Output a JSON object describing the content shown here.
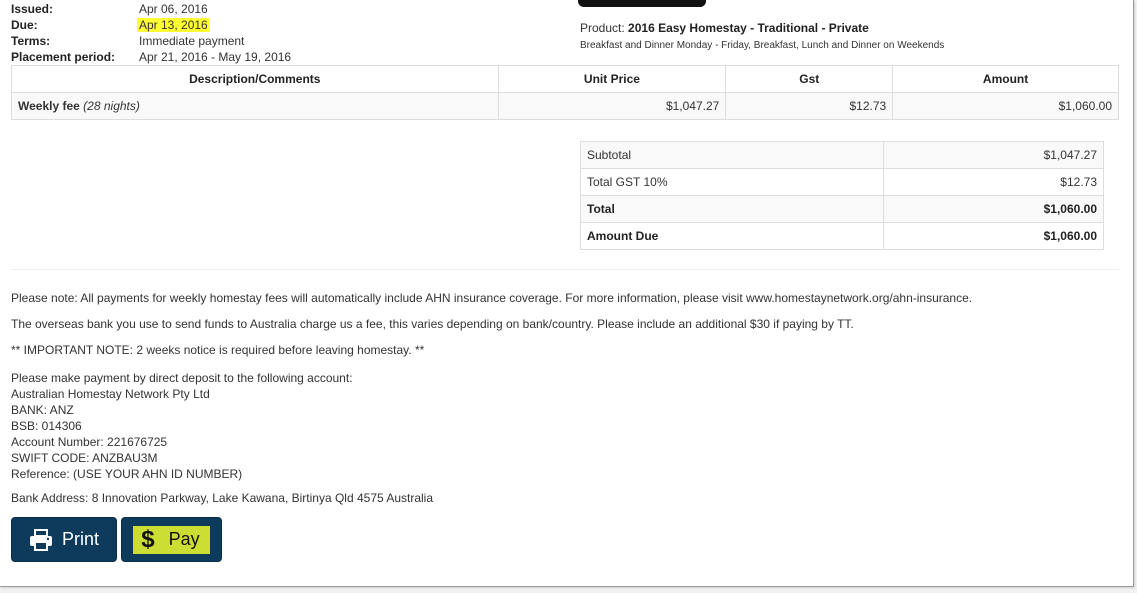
{
  "invoice_meta": {
    "issued_label": "Issued:",
    "issued_value": "Apr 06, 2016",
    "due_label": "Due:",
    "due_value": "Apr 13, 2016",
    "terms_label": "Terms:",
    "terms_value": "Immediate payment",
    "placement_label": "Placement period:",
    "placement_value": "Apr 21, 2016 - May 19, 2016"
  },
  "product": {
    "label": "Product:",
    "name": "2016 Easy Homestay - Traditional - Private",
    "description": "Breakfast and Dinner Monday - Friday, Breakfast, Lunch and Dinner on Weekends"
  },
  "items_table": {
    "headers": [
      "Description/Comments",
      "Unit Price",
      "Gst",
      "Amount"
    ],
    "rows": [
      {
        "description": "Weekly fee",
        "note": "(28 nights)",
        "unit_price": "$1,047.27",
        "gst": "$12.73",
        "amount": "$1,060.00"
      }
    ]
  },
  "totals": [
    {
      "label": "Subtotal",
      "value": "$1,047.27"
    },
    {
      "label": "Total GST 10%",
      "value": "$12.73"
    },
    {
      "label": "Total",
      "value": "$1,060.00"
    },
    {
      "label": "Amount Due",
      "value": "$1,060.00"
    }
  ],
  "notes": {
    "insurance": "Please note: All payments for weekly homestay fees will automatically include AHN insurance coverage. For more information, please visit www.homestaynetwork.org/ahn-insurance.",
    "bank_fee": "The overseas bank you use to send funds to Australia charge us a fee, this varies depending on bank/country. Please include an additional $30 if paying by TT.",
    "important": "** IMPORTANT NOTE: 2 weeks notice is required before leaving homestay. **",
    "payment_lines": [
      "Please make payment by direct deposit to the following account:",
      "Australian Homestay Network Pty Ltd",
      "BANK: ANZ",
      "BSB: 014306",
      "Account Number: 221676725",
      "SWIFT CODE: ANZBAU3M",
      "Reference: (USE YOUR AHN ID NUMBER)"
    ],
    "bank_address": "Bank Address: 8 Innovation Parkway, Lake Kawana, Birtinya Qld 4575 Australia"
  },
  "buttons": {
    "print_label": "Print",
    "pay_symbol": "$",
    "pay_label": "Pay"
  },
  "colors": {
    "button_bg": "#0e3a5c",
    "highlight": "#ffff33",
    "pay_highlight": "#ccdd33"
  },
  "icons": {
    "print": "printer-icon"
  }
}
